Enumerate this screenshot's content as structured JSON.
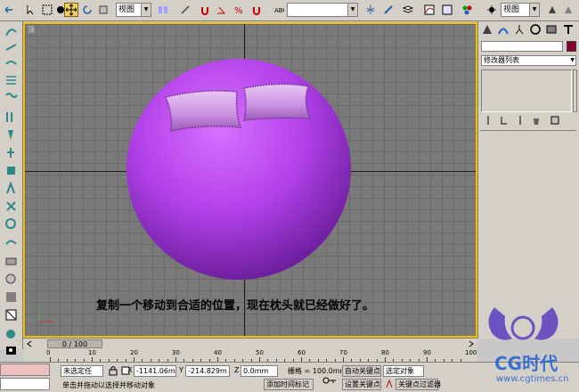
{
  "toolbar": {
    "selection_filter": "视图",
    "coordinate_system": "视图",
    "named_selection": ""
  },
  "viewport": {
    "label": "顶",
    "caption": "复制一个移动到合适的位置，现在枕头就已经做好了。"
  },
  "right_panel": {
    "object_name": "",
    "object_color": "#8a0030",
    "modifier_list": "修改器列表"
  },
  "timeline": {
    "frame_display": "0 / 100",
    "ticks": [
      "0",
      "10",
      "20",
      "30",
      "40",
      "50",
      "60",
      "70",
      "80",
      "90",
      "100"
    ]
  },
  "status": {
    "selection_text": "未选定任",
    "x_label": "X",
    "x_value": "-1141.06mm",
    "y_label": "Y",
    "y_value": "-214.829m",
    "z_label": "Z",
    "z_value": "0.0mm",
    "grid_label": "栅格 = 100.0mm",
    "prompt": "单击并拖动以选择并移动对象",
    "add_time_tag": "添加时间标记",
    "auto_key": "自动关键点",
    "set_key": "设置关键点",
    "selected_filter": "选定对象",
    "key_filters": "关键点过滤器"
  },
  "watermark": {
    "brand": "CG时代",
    "url": "www.cgtimes.cn",
    "colors": {
      "wing": "#5a3cc0",
      "text": "#2060d0"
    }
  }
}
